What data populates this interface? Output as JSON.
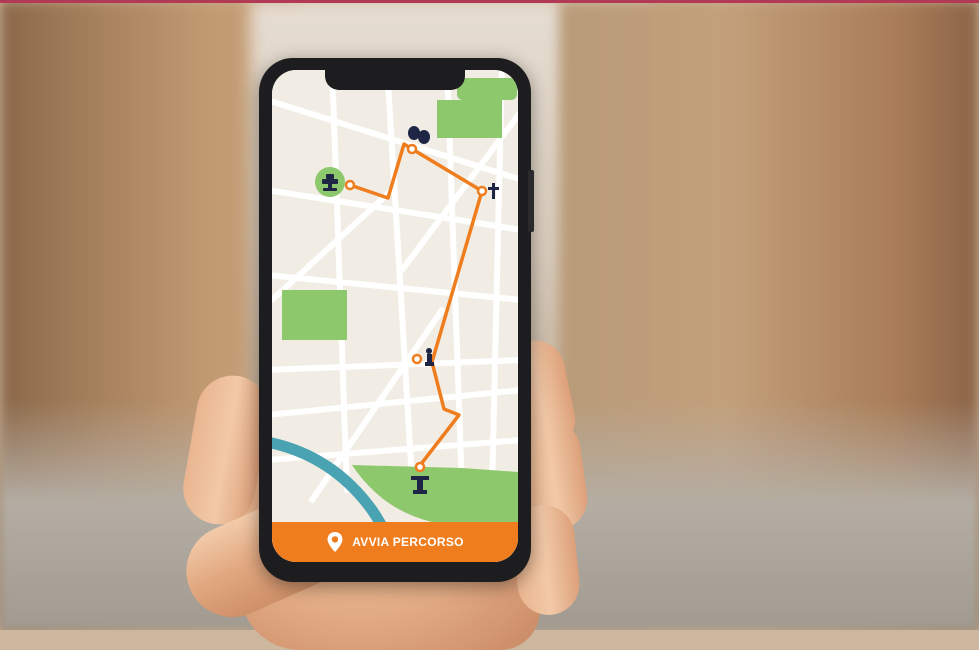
{
  "app": {
    "cta_label": "AVVIA PERCORSO",
    "cta_icon": "map-pin-icon"
  },
  "colors": {
    "route": "#ef7d1e",
    "park": "#8dc86d",
    "river": "#4aa3b3",
    "map_bg": "#f1ede4",
    "streets": "#ffffff"
  },
  "map_pois": [
    {
      "id": "theater",
      "icon": "theater-masks-icon"
    },
    {
      "id": "church",
      "icon": "cross-icon"
    },
    {
      "id": "fountain",
      "icon": "fountain-icon"
    },
    {
      "id": "statue",
      "icon": "statue-icon"
    },
    {
      "id": "monument",
      "icon": "column-monument-icon"
    }
  ]
}
